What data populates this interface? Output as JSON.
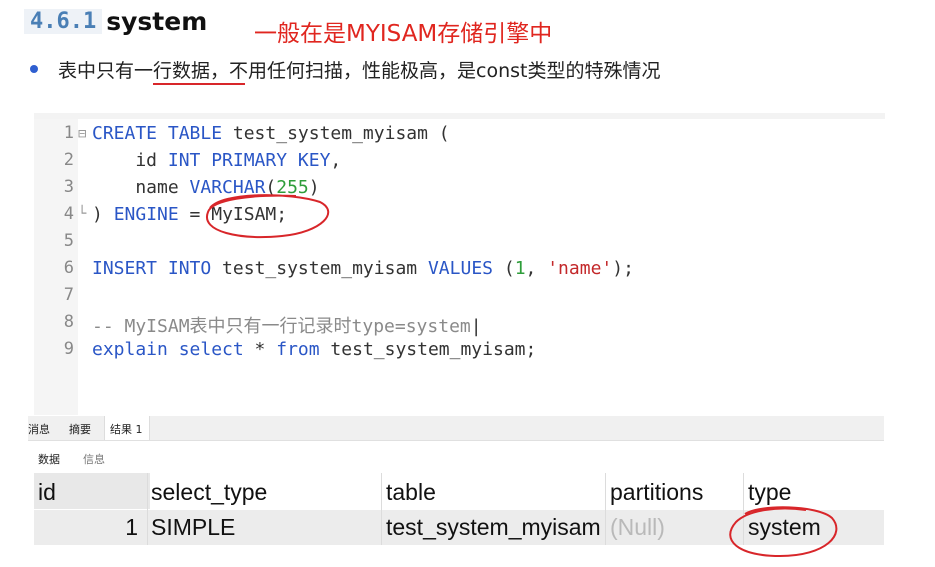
{
  "heading": {
    "number": "4.6.1",
    "title": "system"
  },
  "note": "一般在是MYISAM存储引擎中",
  "bullet": "表中只有一行数据，不用任何扫描，性能极高，是const类型的特殊情况",
  "editor": {
    "lines": [
      {
        "n": "1"
      },
      {
        "n": "2"
      },
      {
        "n": "3"
      },
      {
        "n": "4"
      },
      {
        "n": "5"
      },
      {
        "n": "6"
      },
      {
        "n": "7"
      },
      {
        "n": "8"
      },
      {
        "n": "9"
      }
    ],
    "code": {
      "l1_kw": "CREATE TABLE",
      "l1_rest": " test_system_myisam (",
      "l2_ident": "    id ",
      "l2_kw": "INT PRIMARY KEY",
      "l2_rest": ",",
      "l3_ident": "    name ",
      "l3_kw": "VARCHAR",
      "l3_open": "(",
      "l3_num": "255",
      "l3_close": ")",
      "l4_open": ") ",
      "l4_kw": "ENGINE",
      "l4_rest": " = MyISAM;",
      "l6_kw1": "INSERT INTO",
      "l6_mid": " test_system_myisam ",
      "l6_kw2": "VALUES",
      "l6_open": " (",
      "l6_num": "1",
      "l6_comma": ", ",
      "l6_str": "'name'",
      "l6_close": ");",
      "l8_comment": "-- MyISAM表中只有一行记录时type=system",
      "l9_kw1": "explain select",
      "l9_mid": " * ",
      "l9_kw2": "from",
      "l9_rest": " test_system_myisam;"
    }
  },
  "tabs": {
    "messages": "消息",
    "summary": "摘要",
    "result": "结果 1"
  },
  "subtabs": {
    "data": "数据",
    "info": "信息"
  },
  "grid": {
    "columns": [
      "id",
      "select_type",
      "table",
      "partitions",
      "type"
    ],
    "row": {
      "id": "1",
      "select_type": "SIMPLE",
      "table": "test_system_myisam",
      "partitions": "(Null)",
      "type": "system"
    }
  },
  "colors": {
    "keyword": "#2a56c6",
    "annotation": "#e0261f",
    "number": "#2e9d3a",
    "string": "#c3282a"
  }
}
